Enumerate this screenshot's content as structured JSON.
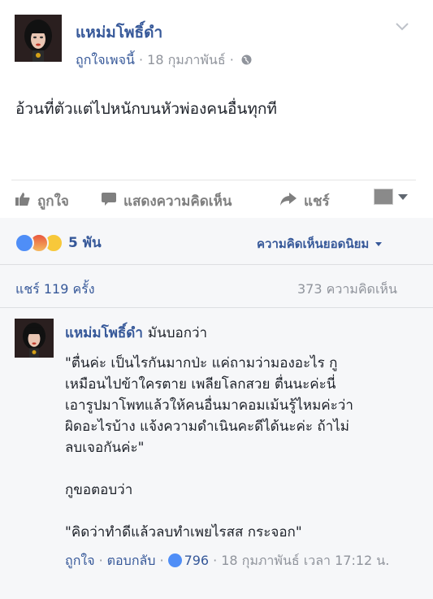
{
  "post": {
    "page_name": "แหม่มโพธิ์ดำ",
    "like_page": "ถูกใจเพจนี้",
    "date": "18 กุมภาพันธ์",
    "text": "อ้วนที่ตัวแต่ไปหนักบนหัวพ่องคนอื่นทุกที"
  },
  "actions": {
    "like": "ถูกใจ",
    "comment": "แสดงความคิดเห็น",
    "share": "แชร์"
  },
  "feedback": {
    "reaction_count": "5 พัน",
    "top_comments": "ความคิดเห็นยอดนิยม",
    "shares": "แชร์ 119 ครั้ง",
    "comments_count": "373 ความคิดเห็น"
  },
  "comment": {
    "author": "แหม่มโพธิ์ดำ",
    "said": "มันบอกว่า",
    "body": "\"ตื่นค่ะ เป็นไรกันมากป่ะ แค่ถามว่ามองอะไร กู\nเหมือนไปข้าใครตาย เพลียโลกสวย ตื่นนะค่ะนี่\nเอารูปมาโพทแล้วให้คนอื่นมาคอมเม้นรู้ไหมค่ะว่า\nผิดอะไรบ้าง แจ้งความดำเนินคะดีได้นะค่ะ ถ้าไม่\nลบเจอกันค่ะ\"\n\nกูขอตอบว่า\n\n\"คิดว่าทำดีแล้วลบทำเพยไรสส กระจอก\"",
    "like": "ถูกใจ",
    "reply": "ตอบกลับ",
    "likes": "796",
    "timestamp": "18 กุมภาพันธ์ เวลา 17:12 น."
  },
  "colors": {
    "link": "#365899",
    "meta": "#90949c",
    "text": "#1d2129",
    "like_blue": "#4f8ef7"
  }
}
